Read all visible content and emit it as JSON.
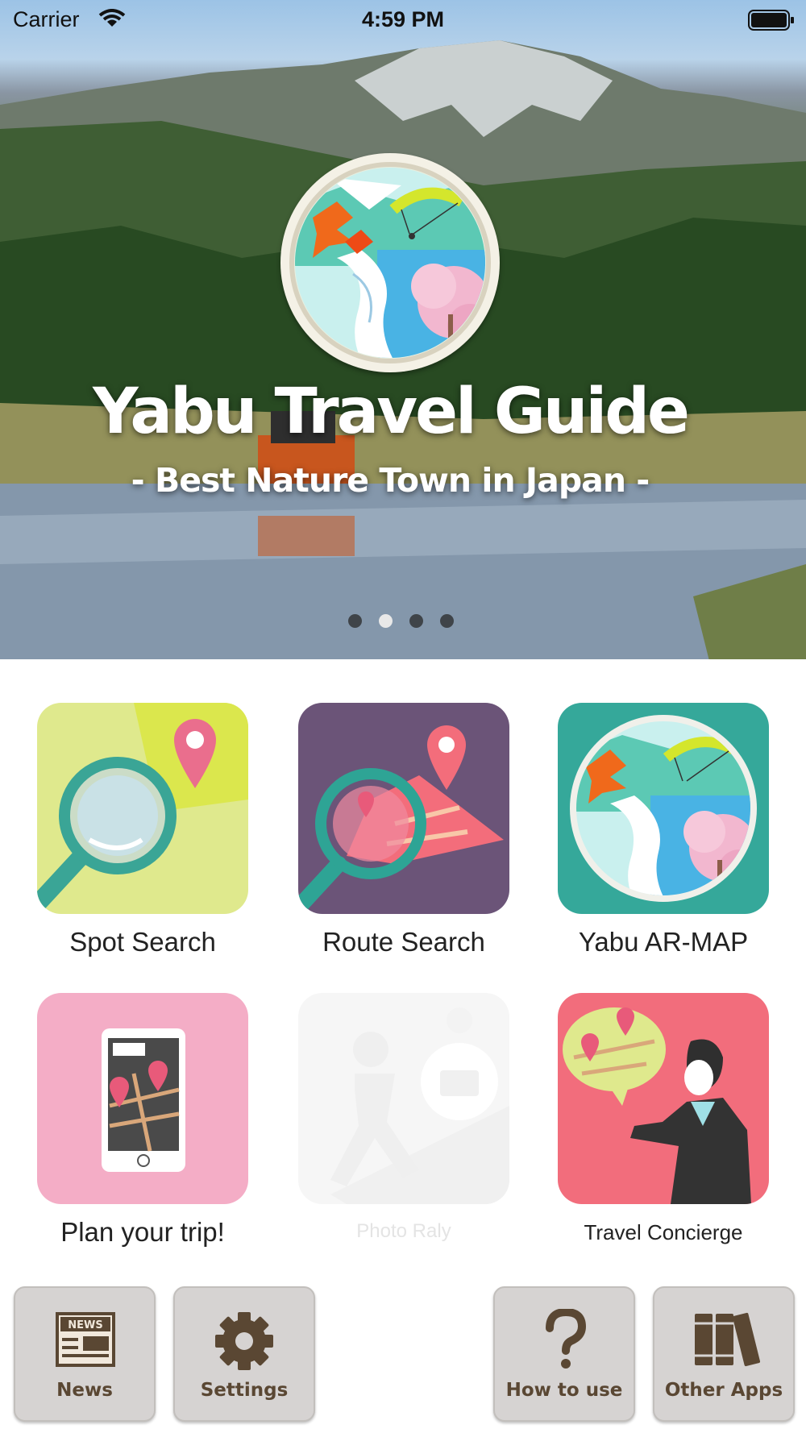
{
  "status_bar": {
    "carrier": "Carrier",
    "time": "4:59 PM"
  },
  "hero": {
    "title": "Yabu Travel Guide",
    "subtitle": "- Best Nature Town in Japan -",
    "page_count": 4,
    "active_page": 2
  },
  "tiles": [
    {
      "label": "Spot Search",
      "bg": "#dfe98d"
    },
    {
      "label": "Route Search",
      "bg": "#6b5478"
    },
    {
      "label": "Yabu AR-MAP",
      "bg": "#35a89a"
    },
    {
      "label": "Plan your trip!",
      "bg": "#f4adc6"
    },
    {
      "label": "Photo Raly",
      "bg": "#f6f6f6"
    },
    {
      "label": "Travel Concierge",
      "bg": "#f26d7c"
    }
  ],
  "bottom_buttons": [
    {
      "label": "News",
      "badge": "NEWS"
    },
    {
      "label": "Settings"
    },
    {
      "label": "How to use"
    },
    {
      "label": "Other Apps"
    }
  ],
  "colors": {
    "button_text": "#5a4733",
    "button_bg": "#d6d3d2",
    "teal": "#35a89a",
    "pin": "#e85a7a"
  }
}
